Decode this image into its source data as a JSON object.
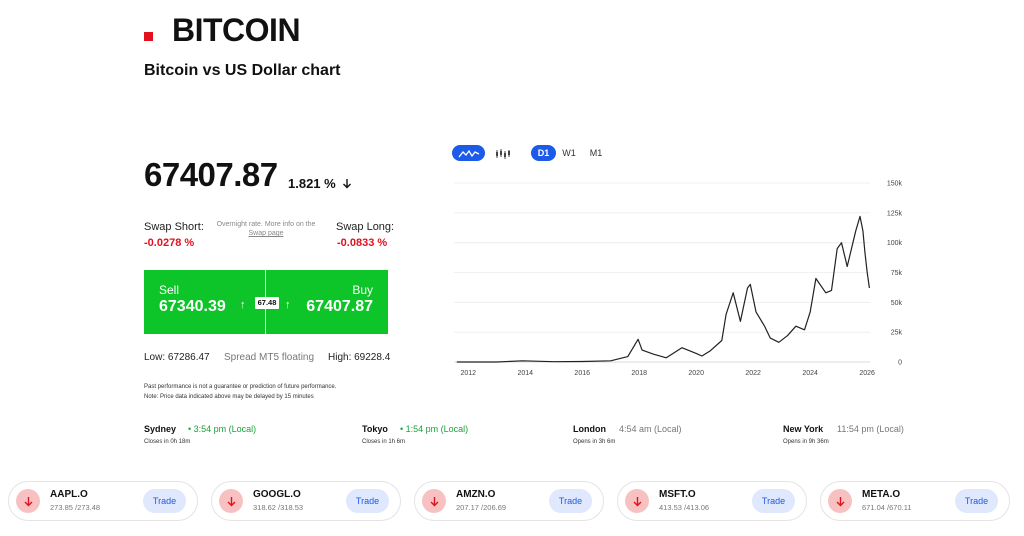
{
  "header": {
    "title": "BITCOIN",
    "subtitle": "Bitcoin vs US Dollar chart",
    "accent_color": "#e3101e"
  },
  "quote": {
    "price": "67407.87",
    "change": "1.821 %",
    "change_direction_icon": "arrow-down-icon"
  },
  "swap": {
    "short_label": "Swap Short:",
    "short_value": "-0.0278 %",
    "note_line1": "Overnight rate. More info on the",
    "note_link": "Swap page",
    "long_label": "Swap Long:",
    "long_value": "-0.0833 %",
    "negative_color": "#e3101e"
  },
  "trade": {
    "sell_label": "Sell",
    "sell_price": "67340.39",
    "buy_label": "Buy",
    "buy_price": "67407.87",
    "spread_value": "67.48",
    "up_arrow": "↑",
    "box_color": "#0dc528"
  },
  "range": {
    "low": "Low: 67286.47",
    "spread_type": "Spread MT5 floating",
    "high": "High: 69228.4"
  },
  "disclaimer": {
    "line1": "Past performance is not a guarantee or prediction of future performance.",
    "line2": "Note: Price data indicated above may be delayed by 15 minutes"
  },
  "chart_controls": {
    "line_icon": "line-chart-icon",
    "candle_icon": "candlestick-icon",
    "timeframes": [
      "D1",
      "W1",
      "M1"
    ],
    "active_timeframe": "D1",
    "active_color": "#1c5ae8"
  },
  "chart_data": {
    "type": "line",
    "x_ticks": [
      "2012",
      "2014",
      "2016",
      "2018",
      "2020",
      "2022",
      "2024",
      "2026"
    ],
    "y_ticks": [
      "0",
      "25k",
      "50k",
      "75k",
      "100k",
      "125k",
      "150k"
    ],
    "ylim": [
      0,
      150000
    ],
    "xlim": [
      2011.5,
      2026.1
    ],
    "grid": true,
    "y_axis_side": "right",
    "series": [
      {
        "x": [
          2011.6,
          2013.0,
          2013.9,
          2015.0,
          2016.0,
          2017.0,
          2017.6,
          2017.96,
          2018.1,
          2018.5,
          2018.95,
          2019.5,
          2020.0,
          2020.2,
          2020.5,
          2020.9,
          2021.05,
          2021.3,
          2021.55,
          2021.8,
          2021.9,
          2022.1,
          2022.4,
          2022.6,
          2022.9,
          2023.2,
          2023.5,
          2023.8,
          2024.0,
          2024.2,
          2024.55,
          2024.75,
          2024.95,
          2025.1,
          2025.3,
          2025.6,
          2025.75,
          2025.85,
          2025.92,
          2026.0,
          2026.08
        ],
        "y": [
          5,
          13,
          1000,
          250,
          430,
          1000,
          4500,
          19000,
          10000,
          6500,
          3500,
          12000,
          7200,
          5000,
          9500,
          18000,
          40000,
          58000,
          34000,
          62000,
          65000,
          42000,
          30000,
          20000,
          16500,
          22000,
          30000,
          27000,
          42000,
          70000,
          58000,
          60000,
          95000,
          100000,
          80000,
          110000,
          122000,
          110000,
          92000,
          75000,
          62000
        ],
        "color": "#222222"
      }
    ]
  },
  "markets": [
    {
      "city": "Sydney",
      "time": "• 3:54 pm (Local)",
      "status": "open",
      "sub": "Closes in 0h 18m"
    },
    {
      "city": "Tokyo",
      "time": "• 1:54 pm (Local)",
      "status": "open",
      "sub": "Closes in 1h 6m"
    },
    {
      "city": "London",
      "time": "4:54 am (Local)",
      "status": "closed",
      "sub": "Opens in 3h 6m"
    },
    {
      "city": "New York",
      "time": "11:54 pm (Local)",
      "status": "closed",
      "sub": "Opens in 9h 36m"
    }
  ],
  "stocks": [
    {
      "symbol": "AAPL.O",
      "bidask": "273.85 /273.48",
      "trade_label": "Trade",
      "icon": "arrow-down-icon"
    },
    {
      "symbol": "GOOGL.O",
      "bidask": "318.62 /318.53",
      "trade_label": "Trade",
      "icon": "arrow-down-icon"
    },
    {
      "symbol": "AMZN.O",
      "bidask": "207.17 /206.69",
      "trade_label": "Trade",
      "icon": "arrow-down-icon"
    },
    {
      "symbol": "MSFT.O",
      "bidask": "413.53 /413.06",
      "trade_label": "Trade",
      "icon": "arrow-down-icon"
    },
    {
      "symbol": "META.O",
      "bidask": "671.04 /670.11",
      "trade_label": "Trade",
      "icon": "arrow-down-icon"
    }
  ]
}
